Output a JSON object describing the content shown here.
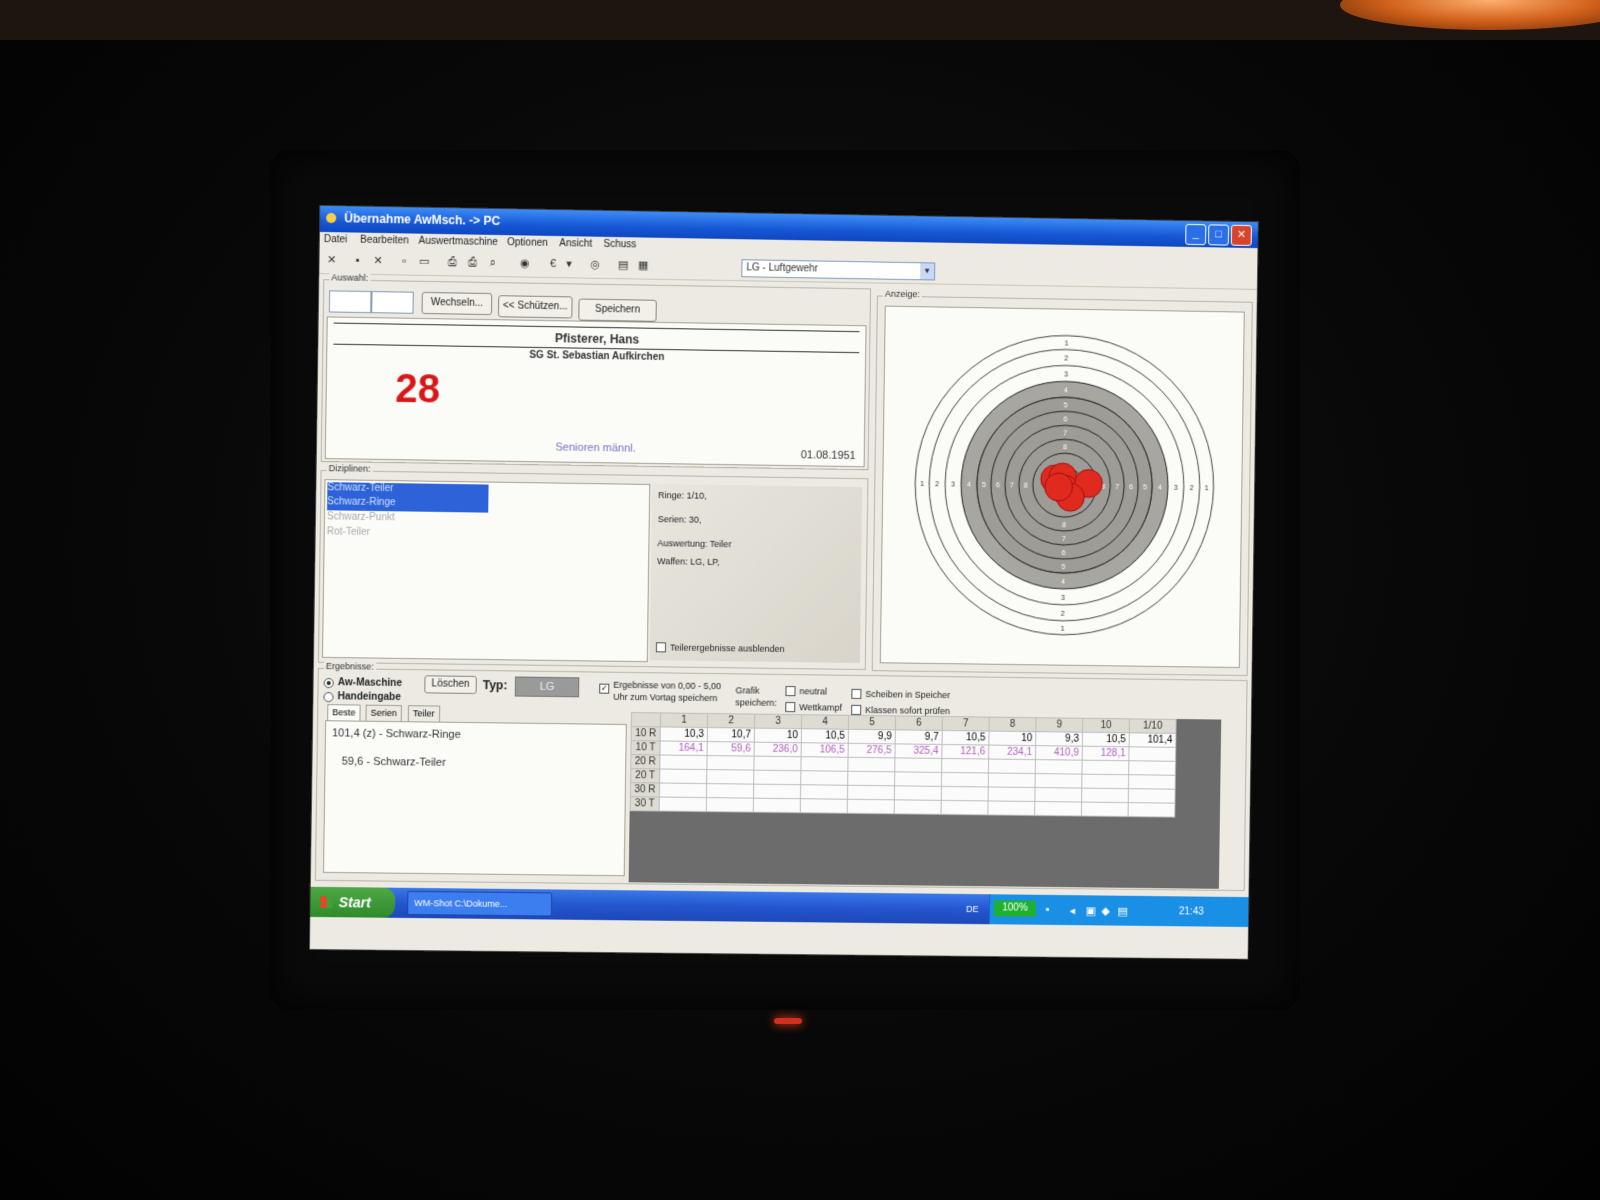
{
  "window": {
    "title": "Übernahme AwMsch. -> PC"
  },
  "menu": [
    "Datei",
    "Bearbeiten",
    "Auswertmaschine",
    "Optionen",
    "Ansicht",
    "Schuss"
  ],
  "toolbar": {
    "weapon_select": "LG - Luftgewehr"
  },
  "auswahl": {
    "label": "Auswahl:",
    "btn_wechseln": "Wechseln...",
    "btn_schuetzen": "<< Schützen...",
    "btn_speichern": "Speichern"
  },
  "shooter": {
    "name": "Pfisterer, Hans",
    "club": "SG St. Sebastian Aufkirchen",
    "number": "28",
    "class": "Senioren männl.",
    "date": "01.08.1951"
  },
  "disziplinen": {
    "label": "Diziplinen:",
    "items": [
      "Schwarz-Teiler",
      "Schwarz-Ringe",
      "Schwarz-Punkt",
      "Rot-Teiler"
    ],
    "info": [
      "Ringe: 1/10,",
      "Serien: 30,",
      "Auswertung: Teiler",
      "Waffen: LG, LP,"
    ],
    "hide_teiler": "Teilerergebnisse ausblenden"
  },
  "anzeige": {
    "label": "Anzeige:"
  },
  "target": {
    "ring_numbers": [
      "1",
      "2",
      "3",
      "4",
      "5",
      "6",
      "7",
      "8"
    ]
  },
  "ergebnisse": {
    "label": "Ergebnisse:",
    "radio_aw": "Aw-Maschine",
    "radio_hand": "Handeingabe",
    "btn_loeschen": "Löschen",
    "typ_label": "Typ:",
    "typ_value": "LG",
    "opt_range": "Ergebnisse von 0,00 - 5,00",
    "opt_clock": "Uhr zum Vortag speichern",
    "grafik_line1": "Grafik",
    "grafik_line2": "speichern:",
    "opt_neutral": "neutral",
    "opt_wettkampf": "Wettkampf",
    "opt_scheiben": "Scheiben in Speicher",
    "opt_klassen": "Klassen sofort prüfen",
    "tabs": [
      "Beste",
      "Serien",
      "Teiler"
    ],
    "best": [
      "101,4 (z) - Schwarz-Ringe",
      "59,6 - Schwarz-Teiler"
    ]
  },
  "score_table": {
    "columns": [
      "1",
      "2",
      "3",
      "4",
      "5",
      "6",
      "7",
      "8",
      "9",
      "10",
      "1/10"
    ],
    "rows": [
      {
        "label": "10 R",
        "values": [
          "10,3",
          "10,7",
          "10",
          "10,5",
          "9,9",
          "9,7",
          "10,5",
          "10",
          "9,3",
          "10,5",
          "101,4"
        ]
      },
      {
        "label": "10 T",
        "values": [
          "164,1",
          "59,6",
          "236,0",
          "106,5",
          "276,5",
          "325,4",
          "121,6",
          "234,1",
          "410,9",
          "128,1",
          ""
        ]
      },
      {
        "label": "20 R",
        "values": [
          "",
          "",
          "",
          "",
          "",
          "",
          "",
          "",
          "",
          "",
          ""
        ]
      },
      {
        "label": "20 T",
        "values": [
          "",
          "",
          "",
          "",
          "",
          "",
          "",
          "",
          "",
          "",
          ""
        ]
      },
      {
        "label": "30 R",
        "values": [
          "",
          "",
          "",
          "",
          "",
          "",
          "",
          "",
          "",
          "",
          ""
        ]
      },
      {
        "label": "30 T",
        "values": [
          "",
          "",
          "",
          "",
          "",
          "",
          "",
          "",
          "",
          "",
          ""
        ]
      }
    ]
  },
  "taskbar": {
    "start": "Start",
    "task": "WM-Shot C:\\Dokume...",
    "lang": "DE",
    "battery": "100%",
    "clock": "21:43"
  },
  "colors": {
    "accent_red": "#d81818",
    "titlebar_blue": "#1657d6",
    "selection": "#2d62d8",
    "shot_red": "#e02a1e"
  }
}
